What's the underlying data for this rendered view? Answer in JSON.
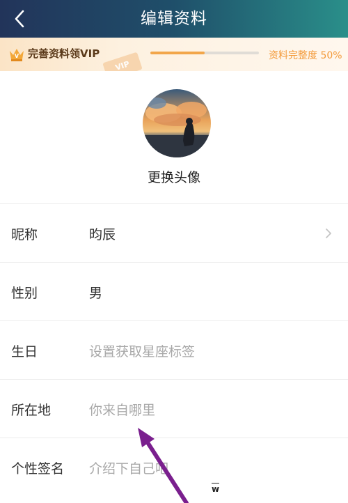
{
  "header": {
    "title": "编辑资料",
    "back_icon": "chevron-left-icon"
  },
  "vip_banner": {
    "text": "完善资料领VIP",
    "tag": "VIP",
    "progress_text": "资料完整度 50%",
    "progress": 0.5,
    "accent_color": "#f39a3a"
  },
  "avatar": {
    "caption": "更换头像"
  },
  "fields": [
    {
      "label": "昵称",
      "value": "昀辰",
      "placeholder": false,
      "has_chevron": true
    },
    {
      "label": "性别",
      "value": "男",
      "placeholder": false,
      "has_chevron": false
    },
    {
      "label": "生日",
      "value": "设置获取星座标签",
      "placeholder": true,
      "has_chevron": false
    },
    {
      "label": "所在地",
      "value": "你来自哪里",
      "placeholder": true,
      "has_chevron": false
    },
    {
      "label": "个性签名",
      "value": "介绍下自己吧",
      "placeholder": true,
      "has_chevron": false
    }
  ],
  "watermark": "w",
  "colors": {
    "header_start": "#22345a",
    "header_end": "#2a8f8a",
    "arrow": "#7a1f8e"
  }
}
